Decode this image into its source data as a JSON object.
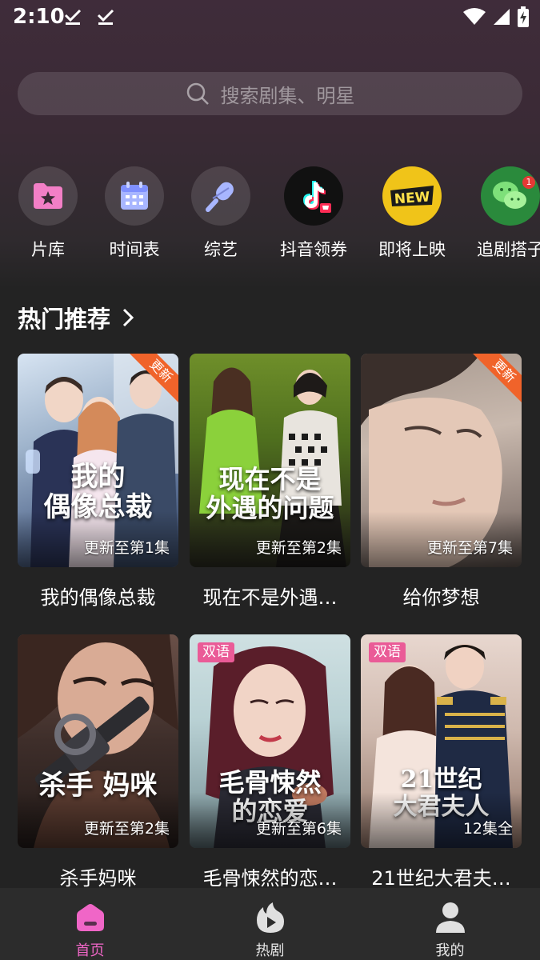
{
  "status_bar": {
    "time": "2:10"
  },
  "search": {
    "placeholder": "搜索剧集、明星"
  },
  "quick_nav": [
    {
      "label": "片库",
      "icon": "folder-star-icon"
    },
    {
      "label": "时间表",
      "icon": "calendar-icon"
    },
    {
      "label": "综艺",
      "icon": "microphone-icon"
    },
    {
      "label": "抖音领券",
      "icon": "tiktok-icon"
    },
    {
      "label": "即将上映",
      "icon": "new-badge-icon"
    },
    {
      "label": "追剧搭子",
      "icon": "wechat-icon",
      "badge": "1"
    }
  ],
  "section": {
    "title": "热门推荐"
  },
  "dramas": [
    {
      "title": "我的偶像总裁",
      "poster_text": "我的偶像总裁",
      "episode": "更新至第1集",
      "ribbon": "更新",
      "tag": ""
    },
    {
      "title": "现在不是外遇…",
      "poster_text": "现在不是外遇的问题",
      "episode": "更新至第2集",
      "ribbon": "",
      "tag": ""
    },
    {
      "title": "给你梦想",
      "poster_text": "",
      "episode": "更新至第7集",
      "ribbon": "更新",
      "tag": ""
    },
    {
      "title": "杀手妈咪",
      "poster_text": "杀手 妈咪",
      "episode": "更新至第2集",
      "ribbon": "",
      "tag": ""
    },
    {
      "title": "毛骨悚然的恋…",
      "poster_text": "毛骨悚然的恋爱",
      "episode": "更新至第6集",
      "ribbon": "",
      "tag": "双语"
    },
    {
      "title": "21世纪大君夫…",
      "poster_text": "21世纪大君夫人",
      "episode": "12集全",
      "ribbon": "",
      "tag": "双语"
    }
  ],
  "bottom_nav": [
    {
      "label": "首页",
      "icon": "home-icon",
      "active": true
    },
    {
      "label": "热剧",
      "icon": "play-flame-icon",
      "active": false
    },
    {
      "label": "我的",
      "icon": "user-icon",
      "active": false
    }
  ],
  "colors": {
    "accent": "#f066c7",
    "ribbon": "#f0632a",
    "tag": "#ea5b97",
    "background": "#232323"
  }
}
